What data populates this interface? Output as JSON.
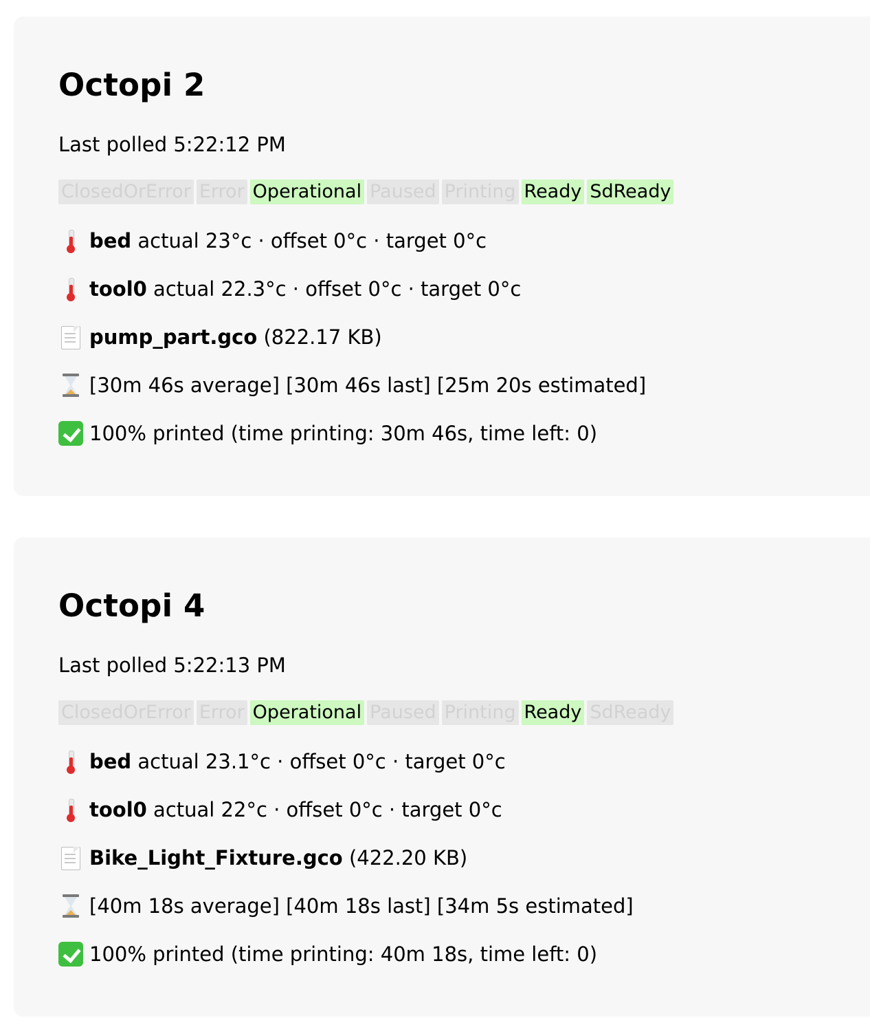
{
  "printers": [
    {
      "title": "Octopi 2",
      "polled": "Last polled 5:22:12 PM",
      "states": [
        {
          "label": "ClosedOrError",
          "active": false
        },
        {
          "label": "Error",
          "active": false
        },
        {
          "label": "Operational",
          "active": true
        },
        {
          "label": "Paused",
          "active": false
        },
        {
          "label": "Printing",
          "active": false
        },
        {
          "label": "Ready",
          "active": true
        },
        {
          "label": "SdReady",
          "active": true
        }
      ],
      "bed": {
        "name": "bed",
        "detail": "actual 23°c · offset 0°c · target 0°c"
      },
      "tool": {
        "name": "tool0",
        "detail": "actual 22.3°c · offset 0°c · target 0°c"
      },
      "file": {
        "name": "pump_part.gco",
        "size": "(822.17 KB)"
      },
      "times": "[30m 46s average] [30m 46s last] [25m 20s estimated]",
      "progress": "100% printed (time printing: 30m 46s, time left: 0)"
    },
    {
      "title": "Octopi 4",
      "polled": "Last polled 5:22:13 PM",
      "states": [
        {
          "label": "ClosedOrError",
          "active": false
        },
        {
          "label": "Error",
          "active": false
        },
        {
          "label": "Operational",
          "active": true
        },
        {
          "label": "Paused",
          "active": false
        },
        {
          "label": "Printing",
          "active": false
        },
        {
          "label": "Ready",
          "active": true
        },
        {
          "label": "SdReady",
          "active": false
        }
      ],
      "bed": {
        "name": "bed",
        "detail": "actual 23.1°c · offset 0°c · target 0°c"
      },
      "tool": {
        "name": "tool0",
        "detail": "actual 22°c · offset 0°c · target 0°c"
      },
      "file": {
        "name": "Bike_Light_Fixture.gco",
        "size": "(422.20 KB)"
      },
      "times": "[40m 18s average] [40m 18s last] [34m 5s estimated]",
      "progress": "100% printed (time printing: 40m 18s, time left: 0)"
    }
  ],
  "icons": {
    "temperature": "thermometer-icon",
    "file": "document-icon",
    "times": "hourglass-icon",
    "progress": "check-mark-icon"
  },
  "colors": {
    "card_background": "#f7f7f7",
    "state_active_background": "#cdf8c0",
    "state_inactive_background": "#e6e6e6",
    "state_inactive_text": "#d2d2d2"
  }
}
